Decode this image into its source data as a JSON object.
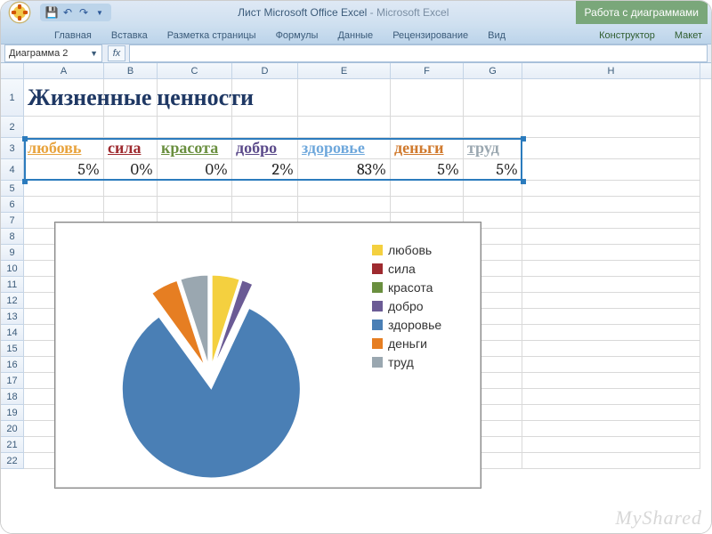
{
  "window": {
    "doc_name": "Лист Microsoft Office Excel",
    "app_name": "Microsoft Excel",
    "chart_tools_label": "Работа с диаграммами"
  },
  "ribbon": {
    "tabs": [
      "Главная",
      "Вставка",
      "Разметка страницы",
      "Формулы",
      "Данные",
      "Рецензирование",
      "Вид"
    ],
    "context_tabs": [
      "Конструктор",
      "Макет"
    ]
  },
  "namebox": {
    "value": "Диаграмма 2"
  },
  "fx_label": "fx",
  "columns": [
    "A",
    "B",
    "C",
    "D",
    "E",
    "F",
    "G",
    "H"
  ],
  "row_numbers": [
    "1",
    "2",
    "3",
    "4",
    "5",
    "6",
    "7",
    "8",
    "9",
    "10",
    "11",
    "12",
    "13",
    "14",
    "15",
    "16",
    "17",
    "18",
    "19",
    "20",
    "21",
    "22"
  ],
  "sheet": {
    "title": "Жизненные ценности",
    "headers": [
      {
        "text": "любовь",
        "color": "#E8A33D"
      },
      {
        "text": "сила",
        "color": "#9E2A2F"
      },
      {
        "text": "красота",
        "color": "#6A8F3F"
      },
      {
        "text": "добро",
        "color": "#5B4A8A"
      },
      {
        "text": "здоровье",
        "color": "#6FA8DC"
      },
      {
        "text": "деньги",
        "color": "#D07A2E"
      },
      {
        "text": "труд",
        "color": "#9AA7B0"
      }
    ],
    "values": [
      "5%",
      "0%",
      "0%",
      "2%",
      "83%",
      "5%",
      "5%"
    ]
  },
  "chart_data": {
    "type": "pie",
    "title": "",
    "categories": [
      "любовь",
      "сила",
      "красота",
      "добро",
      "здоровье",
      "деньги",
      "труд"
    ],
    "values": [
      5,
      0,
      0,
      2,
      83,
      5,
      5
    ],
    "colors": [
      "#F4D03F",
      "#9E2A2F",
      "#6A8F3F",
      "#6B5B95",
      "#4A7FB5",
      "#E67E22",
      "#9AA7B0"
    ],
    "legend_position": "right"
  },
  "watermark": "MyShared"
}
